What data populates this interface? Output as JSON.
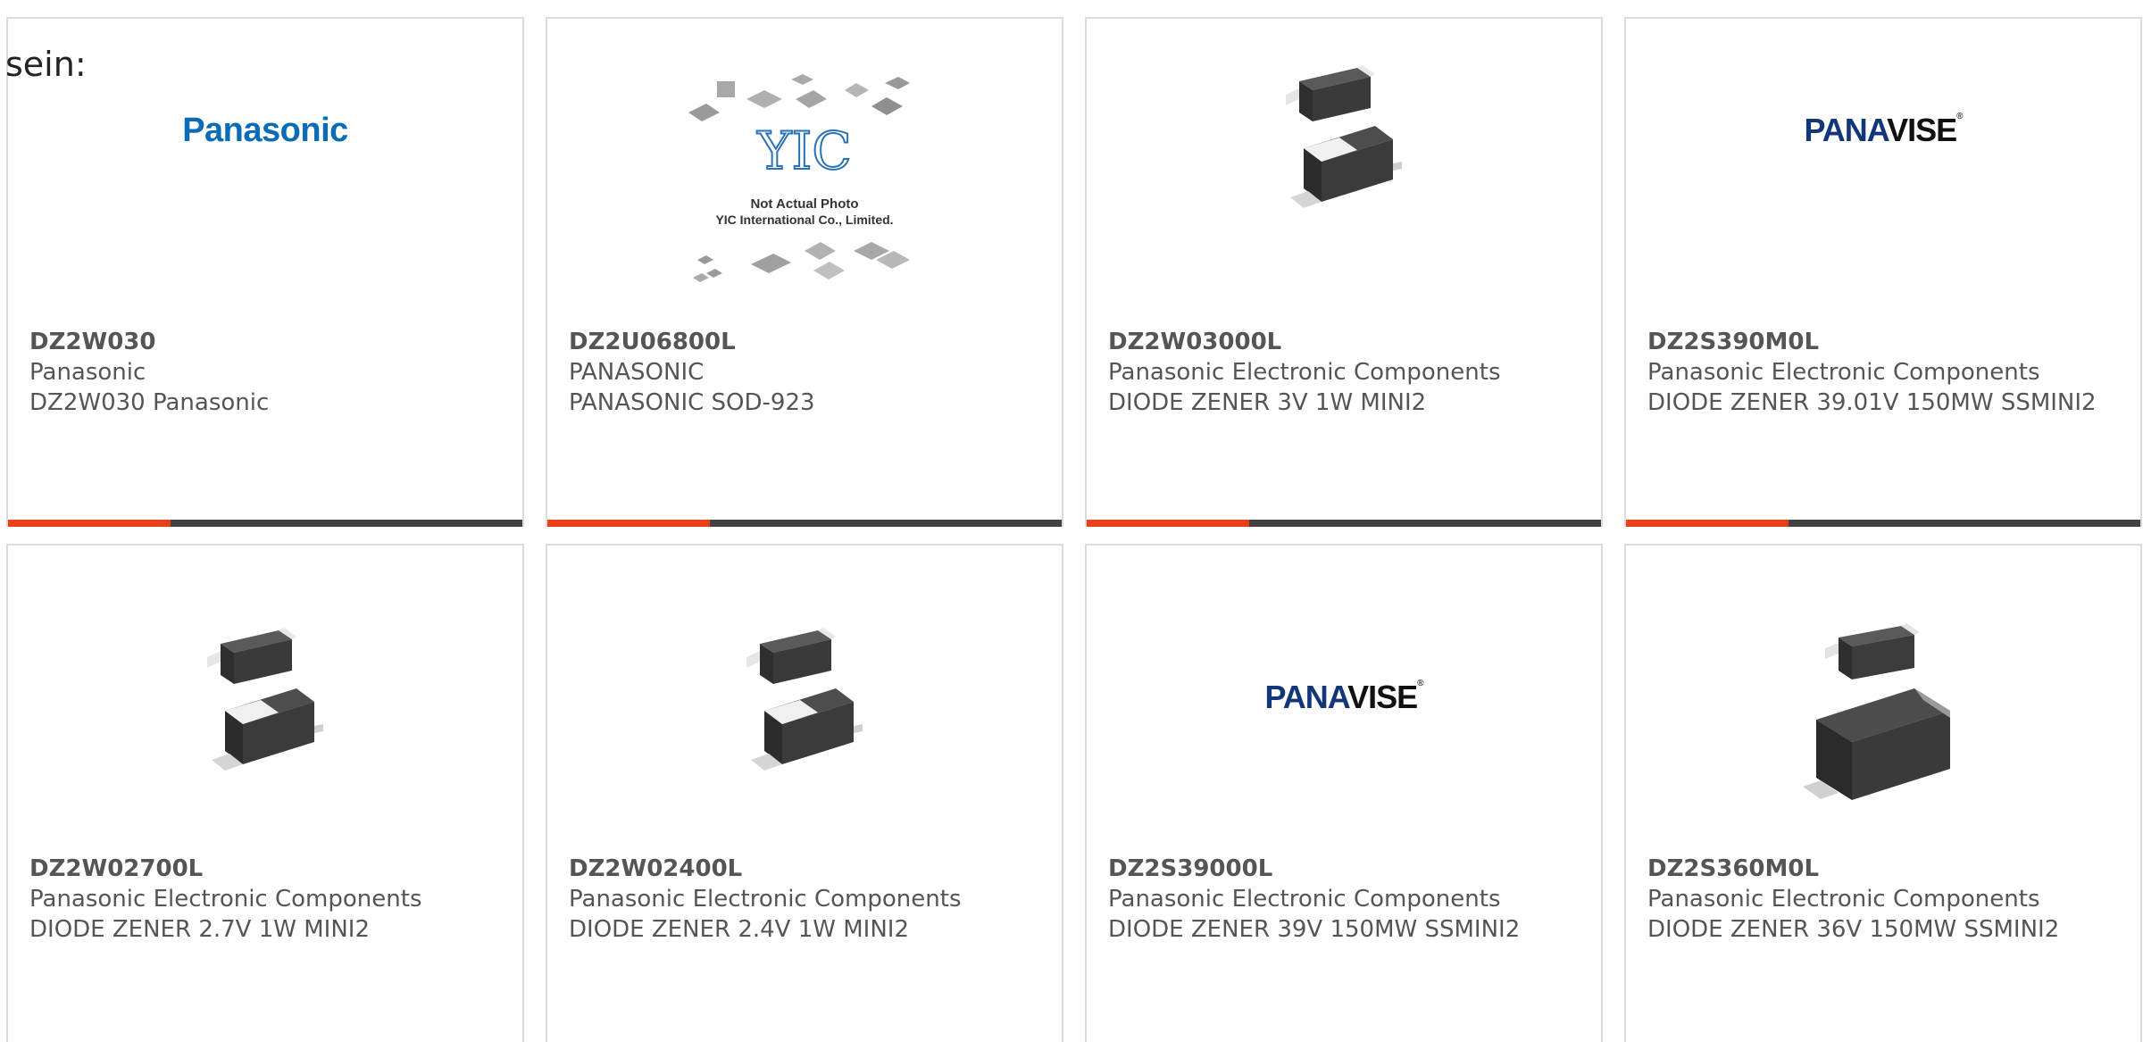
{
  "intro": "sein:",
  "colors": {
    "accent_bar": "#e8411a",
    "dark_bar": "#424242",
    "panasonic_blue": "#0a6bb7",
    "panavise_navy": "#13367a"
  },
  "cards": [
    {
      "part": "DZ2W030",
      "manufacturer": "Panasonic",
      "description": "DZ2W030 Panasonic",
      "image": "panasonic-logo"
    },
    {
      "part": "DZ2U06800L",
      "manufacturer": "PANASONIC",
      "description": "PANASONIC SOD-923",
      "image": "yic-placeholder",
      "image_text": {
        "brand": "YIC",
        "line1": "Not Actual Photo",
        "line2": "YIC International Co., Limited."
      }
    },
    {
      "part": "DZ2W03000L",
      "manufacturer": "Panasonic Electronic Components",
      "description": "DIODE ZENER 3V 1W MINI2",
      "image": "diode-package"
    },
    {
      "part": "DZ2S390M0L",
      "manufacturer": "Panasonic Electronic Components",
      "description": "DIODE ZENER 39.01V 150MW SSMINI2",
      "image": "panavise-logo"
    },
    {
      "part": "DZ2W02700L",
      "manufacturer": "Panasonic Electronic Components",
      "description": "DIODE ZENER 2.7V 1W MINI2",
      "image": "diode-package"
    },
    {
      "part": "DZ2W02400L",
      "manufacturer": "Panasonic Electronic Components",
      "description": "DIODE ZENER 2.4V 1W MINI2",
      "image": "diode-package"
    },
    {
      "part": "DZ2S39000L",
      "manufacturer": "Panasonic Electronic Components",
      "description": "DIODE ZENER 39V 150MW SSMINI2",
      "image": "panavise-logo"
    },
    {
      "part": "DZ2S360M0L",
      "manufacturer": "Panasonic Electronic Components",
      "description": "DIODE ZENER 36V 150MW SSMINI2",
      "image": "diode-package-large"
    }
  ],
  "logos": {
    "panasonic": "Panasonic",
    "panavise_pana": "PANA",
    "panavise_vise": "VISE",
    "panavise_tm": "®"
  }
}
